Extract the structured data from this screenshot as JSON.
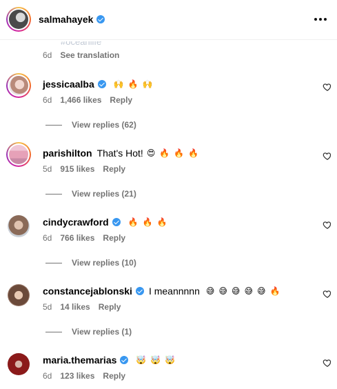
{
  "post": {
    "author": "salmahayek",
    "caption_fragment": "#oceanlife",
    "caption_age": "6d",
    "see_translation": "See translation"
  },
  "comments": [
    {
      "username": "jessicaalba",
      "verified": true,
      "text": "",
      "emojis": [
        "🙌",
        "🔥",
        "🙌"
      ],
      "age": "6d",
      "likes": "1,466 likes",
      "reply": "Reply",
      "view_replies": "View replies (62)"
    },
    {
      "username": "parishilton",
      "verified": false,
      "text": "That's Hot!",
      "emojis": [
        "😍",
        "🔥",
        "🔥",
        "🔥"
      ],
      "age": "5d",
      "likes": "915 likes",
      "reply": "Reply",
      "view_replies": "View replies (21)"
    },
    {
      "username": "cindycrawford",
      "verified": true,
      "text": "",
      "emojis": [
        "🔥",
        "🔥",
        "🔥"
      ],
      "age": "6d",
      "likes": "766 likes",
      "reply": "Reply",
      "view_replies": "View replies (10)"
    },
    {
      "username": "constancejablonski",
      "verified": true,
      "text": "I meannnnn",
      "emojis": [
        "😅",
        "😅",
        "😅",
        "😅",
        "😅",
        "🔥"
      ],
      "age": "5d",
      "likes": "14 likes",
      "reply": "Reply",
      "view_replies": "View replies (1)"
    },
    {
      "username": "maria.themarias",
      "verified": true,
      "text": "",
      "emojis": [
        "🤯",
        "🤯",
        "🤯"
      ],
      "age": "6d",
      "likes": "123 likes",
      "reply": "Reply",
      "view_replies": ""
    }
  ],
  "icons": {
    "more": "more-options-icon",
    "like": "heart-icon",
    "verified": "verified-badge-icon"
  },
  "colors": {
    "verified_blue": "#3897f0",
    "muted_text": "#737373",
    "ring_gradient": [
      "#f7c24b",
      "#f26b2a",
      "#d6249f",
      "#9b36b7"
    ]
  }
}
